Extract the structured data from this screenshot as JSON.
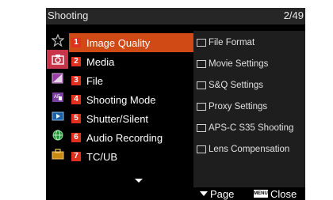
{
  "header": {
    "title": "Shooting",
    "page_indicator": "2/49"
  },
  "tab_icons": [
    "star-icon",
    "camera-shooting-icon",
    "exposure-color-icon",
    "focus-icon",
    "playback-icon",
    "network-icon",
    "toolbox-icon"
  ],
  "categories": [
    {
      "num": "1",
      "label": "Image Quality",
      "selected": true
    },
    {
      "num": "2",
      "label": "Media"
    },
    {
      "num": "3",
      "label": "File"
    },
    {
      "num": "4",
      "label": "Shooting Mode"
    },
    {
      "num": "5",
      "label": "Shutter/Silent"
    },
    {
      "num": "6",
      "label": "Audio Recording"
    },
    {
      "num": "7",
      "label": "TC/UB"
    }
  ],
  "submenu": [
    {
      "icon": "file-format-icon",
      "label": "File Format"
    },
    {
      "icon": "movie-settings-icon",
      "label": "Movie Settings"
    },
    {
      "icon": "sq-settings-icon",
      "label": "S&Q Settings"
    },
    {
      "icon": "proxy-settings-icon",
      "label": "Proxy Settings"
    },
    {
      "icon": "aps-c-s35-icon",
      "label": "APS-C S35 Shooting"
    },
    {
      "icon": "lens-compensation-icon",
      "label": "Lens Compensation"
    }
  ],
  "footer": {
    "page_label": "Page",
    "close_label": "Close",
    "menu_key_label": "MENU"
  },
  "colors": {
    "selected_bg": "#cf4a14",
    "number_badge": "#e0301e",
    "submenu_bg": "#1e1e1e",
    "topbar_bg": "#262626"
  }
}
